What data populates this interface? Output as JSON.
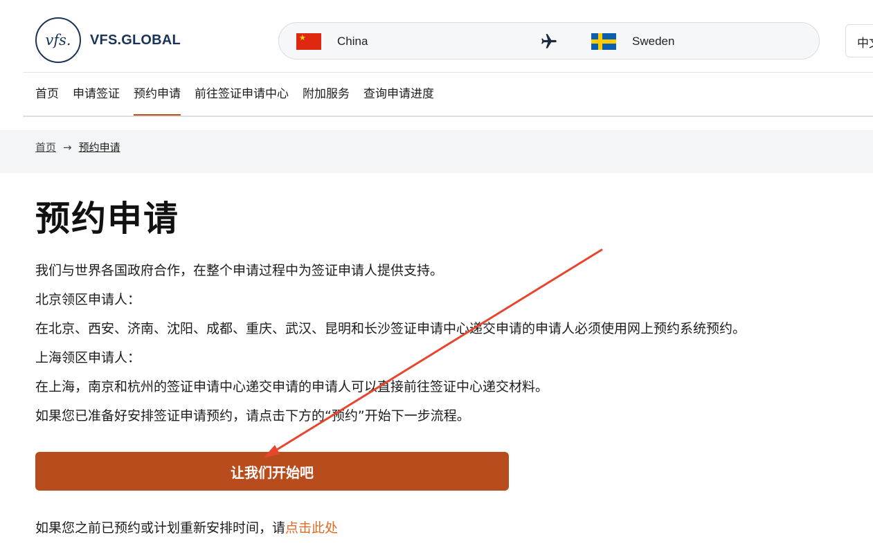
{
  "header": {
    "logo_mark": "vfs.",
    "logo_text": "VFS.GLOBAL",
    "route": {
      "from_country": "China",
      "to_country": "Sweden",
      "from_flag": "china-flag-icon",
      "to_flag": "sweden-flag-icon",
      "arrow_icon": "airplane-icon"
    },
    "language": "中文"
  },
  "nav": {
    "items": [
      {
        "label": "首页"
      },
      {
        "label": "申请签证"
      },
      {
        "label": "预约申请"
      },
      {
        "label": "前往签证申请中心"
      },
      {
        "label": "附加服务"
      },
      {
        "label": "查询申请进度"
      }
    ],
    "active_index": 2
  },
  "breadcrumb": {
    "home": "首页",
    "current": "预约申请"
  },
  "main": {
    "title": "预约申请",
    "paragraphs": [
      "我们与世界各国政府合作，在整个申请过程中为签证申请人提供支持。",
      "北京领区申请人：",
      "在北京、西安、济南、沈阳、成都、重庆、武汉、昆明和长沙签证申请中心递交申请的申请人必须使用网上预约系统预约。",
      "上海领区申请人：",
      "在上海，南京和杭州的签证申请中心递交申请的申请人可以直接前往签证中心递交材料。",
      "如果您已准备好安排签证申请预约，请点击下方的“预约”开始下一步流程。"
    ],
    "cta_label": "让我们开始吧",
    "reschedule_text": "如果您之前已预约或计划重新安排时间，请",
    "reschedule_link": "点击此处"
  },
  "colors": {
    "brand_navy": "#1b3356",
    "accent": "#b84c1c",
    "link": "#e06a20",
    "annotation_arrow": "#e8452f"
  }
}
